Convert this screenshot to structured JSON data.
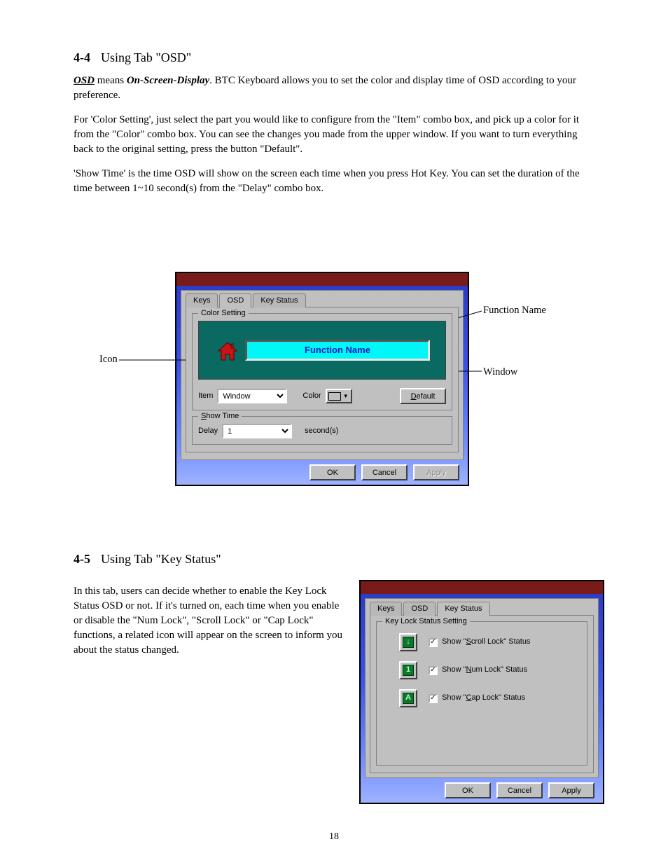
{
  "section4": {
    "title_num": "4-4",
    "title": "Using Tab \"OSD\"",
    "p1_a": "OSD",
    "p1_b": " means ",
    "p1_c": "On-Screen-Display",
    "p1_d": ". BTC Keyboard allows you to set the color and display time of OSD according to your preference.",
    "p2": "For 'Color Setting', just select the part you would like to configure from the \"Item\" combo box, and pick up a color for it from the \"Color\" combo box. You can see the changes you made from the upper window. If you want to turn everything back to the original setting, press the button \"Default\".",
    "p3": "'Show Time' is the time OSD will show on the screen each time when you press Hot Key. You can set the duration of the time between 1~10 second(s) from the \"Delay\" combo box."
  },
  "osd_dialog": {
    "tabs": {
      "keys": "Keys",
      "osd": "OSD",
      "keystatus": "Key Status"
    },
    "group_color": "Color Setting",
    "function_name": "Function Name",
    "item_label": "Item",
    "item_value": "Window",
    "color_label": "Color",
    "default_btn": "Default",
    "default_accel": "D",
    "group_showtime": "Show Time",
    "showtime_accel": "S",
    "delay_label": "Delay",
    "delay_value": "1",
    "seconds_label": "second(s)",
    "ok": "OK",
    "cancel": "Cancel",
    "apply": "Apply"
  },
  "callouts": {
    "icon": "Icon",
    "function_name": "Function Name",
    "window": "Window"
  },
  "section5": {
    "title_num": "4-5",
    "title": "Using Tab \"Key Status\"",
    "p1": "In this tab, users can decide whether to enable the Key Lock Status OSD or not. If it's turned on, each time when you enable or disable the \"Num Lock\", \"Scroll Lock\" or \"Cap Lock\" functions, a related icon will appear on the screen to inform you about the status changed."
  },
  "ks_dialog": {
    "tabs": {
      "keys": "Keys",
      "osd": "OSD",
      "keystatus": "Key Status"
    },
    "group": "Key Lock Status Setting",
    "scroll": "Show \"Scroll Lock\" Status",
    "num": "Show \"Num Lock\" Status",
    "cap": "Show \"Cap Lock\" Status",
    "scroll_accel": "S",
    "num_accel": "N",
    "cap_accel": "C",
    "icon_scroll": "↓",
    "icon_num": "1",
    "icon_cap": "A",
    "ok": "OK",
    "cancel": "Cancel",
    "apply": "Apply"
  },
  "page_number": "18"
}
